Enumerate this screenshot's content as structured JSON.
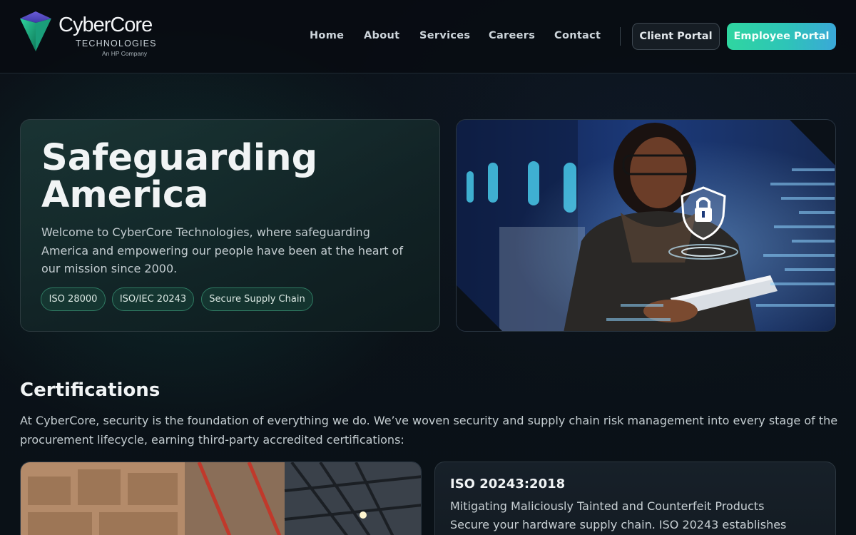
{
  "brand": {
    "name": "CyberCore",
    "tagline": "TECHNOLOGIES",
    "parent": "An HP Company"
  },
  "nav": {
    "items": [
      {
        "label": "Home"
      },
      {
        "label": "About"
      },
      {
        "label": "Services"
      },
      {
        "label": "Careers"
      },
      {
        "label": "Contact"
      }
    ],
    "client_portal": "Client Portal",
    "employee_portal": "Employee Portal"
  },
  "hero": {
    "title": "Safeguarding America",
    "text": "Welcome to CyberCore Technologies, where safeguarding America and empowering our people have been at the heart of our mission since 2000.",
    "badges": [
      "ISO 28000",
      "ISO/IEC 20243",
      "Secure Supply Chain"
    ]
  },
  "certifications": {
    "title": "Certifications",
    "text": "At CyberCore, security is the foundation of everything we do. We’ve woven security and supply chain risk management into every stage of the procurement lifecycle, earning third-party accredited certifications:",
    "card": {
      "title": "ISO 20243:2018",
      "subtitle": "Mitigating Maliciously Tainted and Counterfeit Products",
      "desc": "Secure your hardware supply chain. ISO 20243 establishes"
    }
  },
  "colors": {
    "accent_start": "#2fd6a0",
    "accent_end": "#3aa8d8",
    "background": "#0b1118"
  },
  "icons": {
    "logo": "cybercore-diamond-logo",
    "hero_lock": "shield-lock-icon"
  }
}
